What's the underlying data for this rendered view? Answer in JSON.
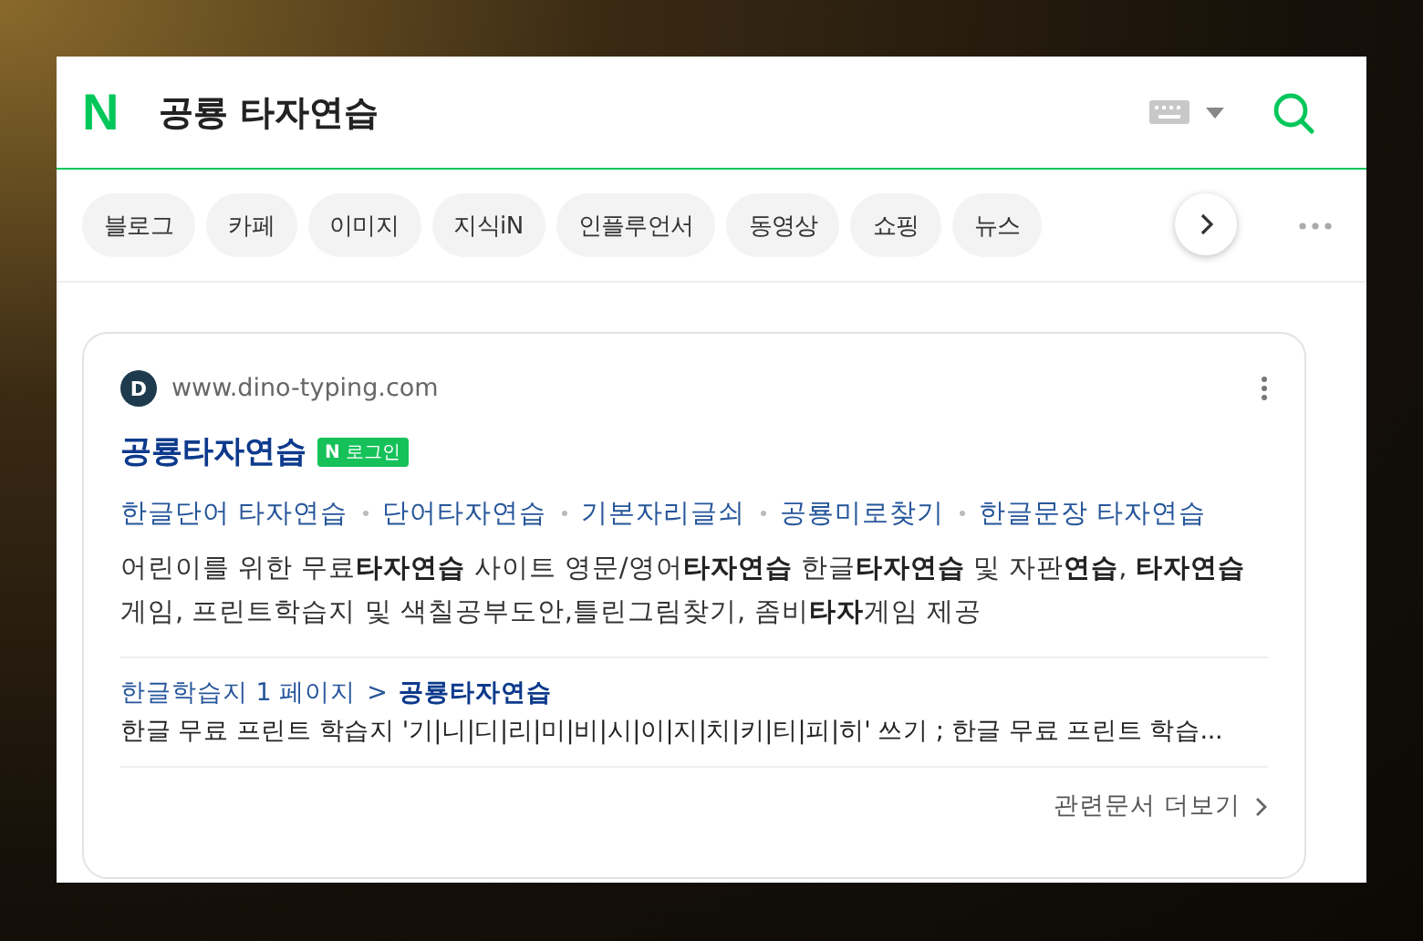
{
  "search": {
    "logo": "N",
    "query": "공룡 타자연습"
  },
  "tabs": [
    {
      "label": "블로그",
      "selected": false
    },
    {
      "label": "카페",
      "selected": false
    },
    {
      "label": "이미지",
      "selected": false
    },
    {
      "label": "지식iN",
      "selected": false
    },
    {
      "label": "인플루언서",
      "selected": false
    },
    {
      "label": "동영상",
      "selected": false
    },
    {
      "label": "쇼핑",
      "selected": false
    },
    {
      "label": "뉴스",
      "selected": false
    }
  ],
  "result": {
    "site_initial": "D",
    "url": "www.dino-typing.com",
    "title": "공룡타자연습",
    "badge_logo": "N",
    "badge": "로그인",
    "sitelinks": [
      "한글단어 타자연습",
      "단어타자연습",
      "기본자리글쇠",
      "공룡미로찾기",
      "한글문장 타자연습"
    ],
    "description": "어린이를 위한 무료**타자연습** 사이트 영문/영어**타자연습** 한글**타자연습** 및 자판**연습**, **타자연습**게임, 프린트학습지 및 색칠공부도안,틀린그림찾기, 좀비**타자**게임 제공",
    "sub_path": "한글학습지 1 페이지",
    "sub_separator": ">",
    "sub_title": "공룡타자연습",
    "sub_description": "한글 무료 프린트 학습지 '기|니|디|리|미|비|시|이|지|치|키|티|피|히' 쓰기 ; 한글 무료 프린트 학습...",
    "more": "관련문서 더보기"
  }
}
